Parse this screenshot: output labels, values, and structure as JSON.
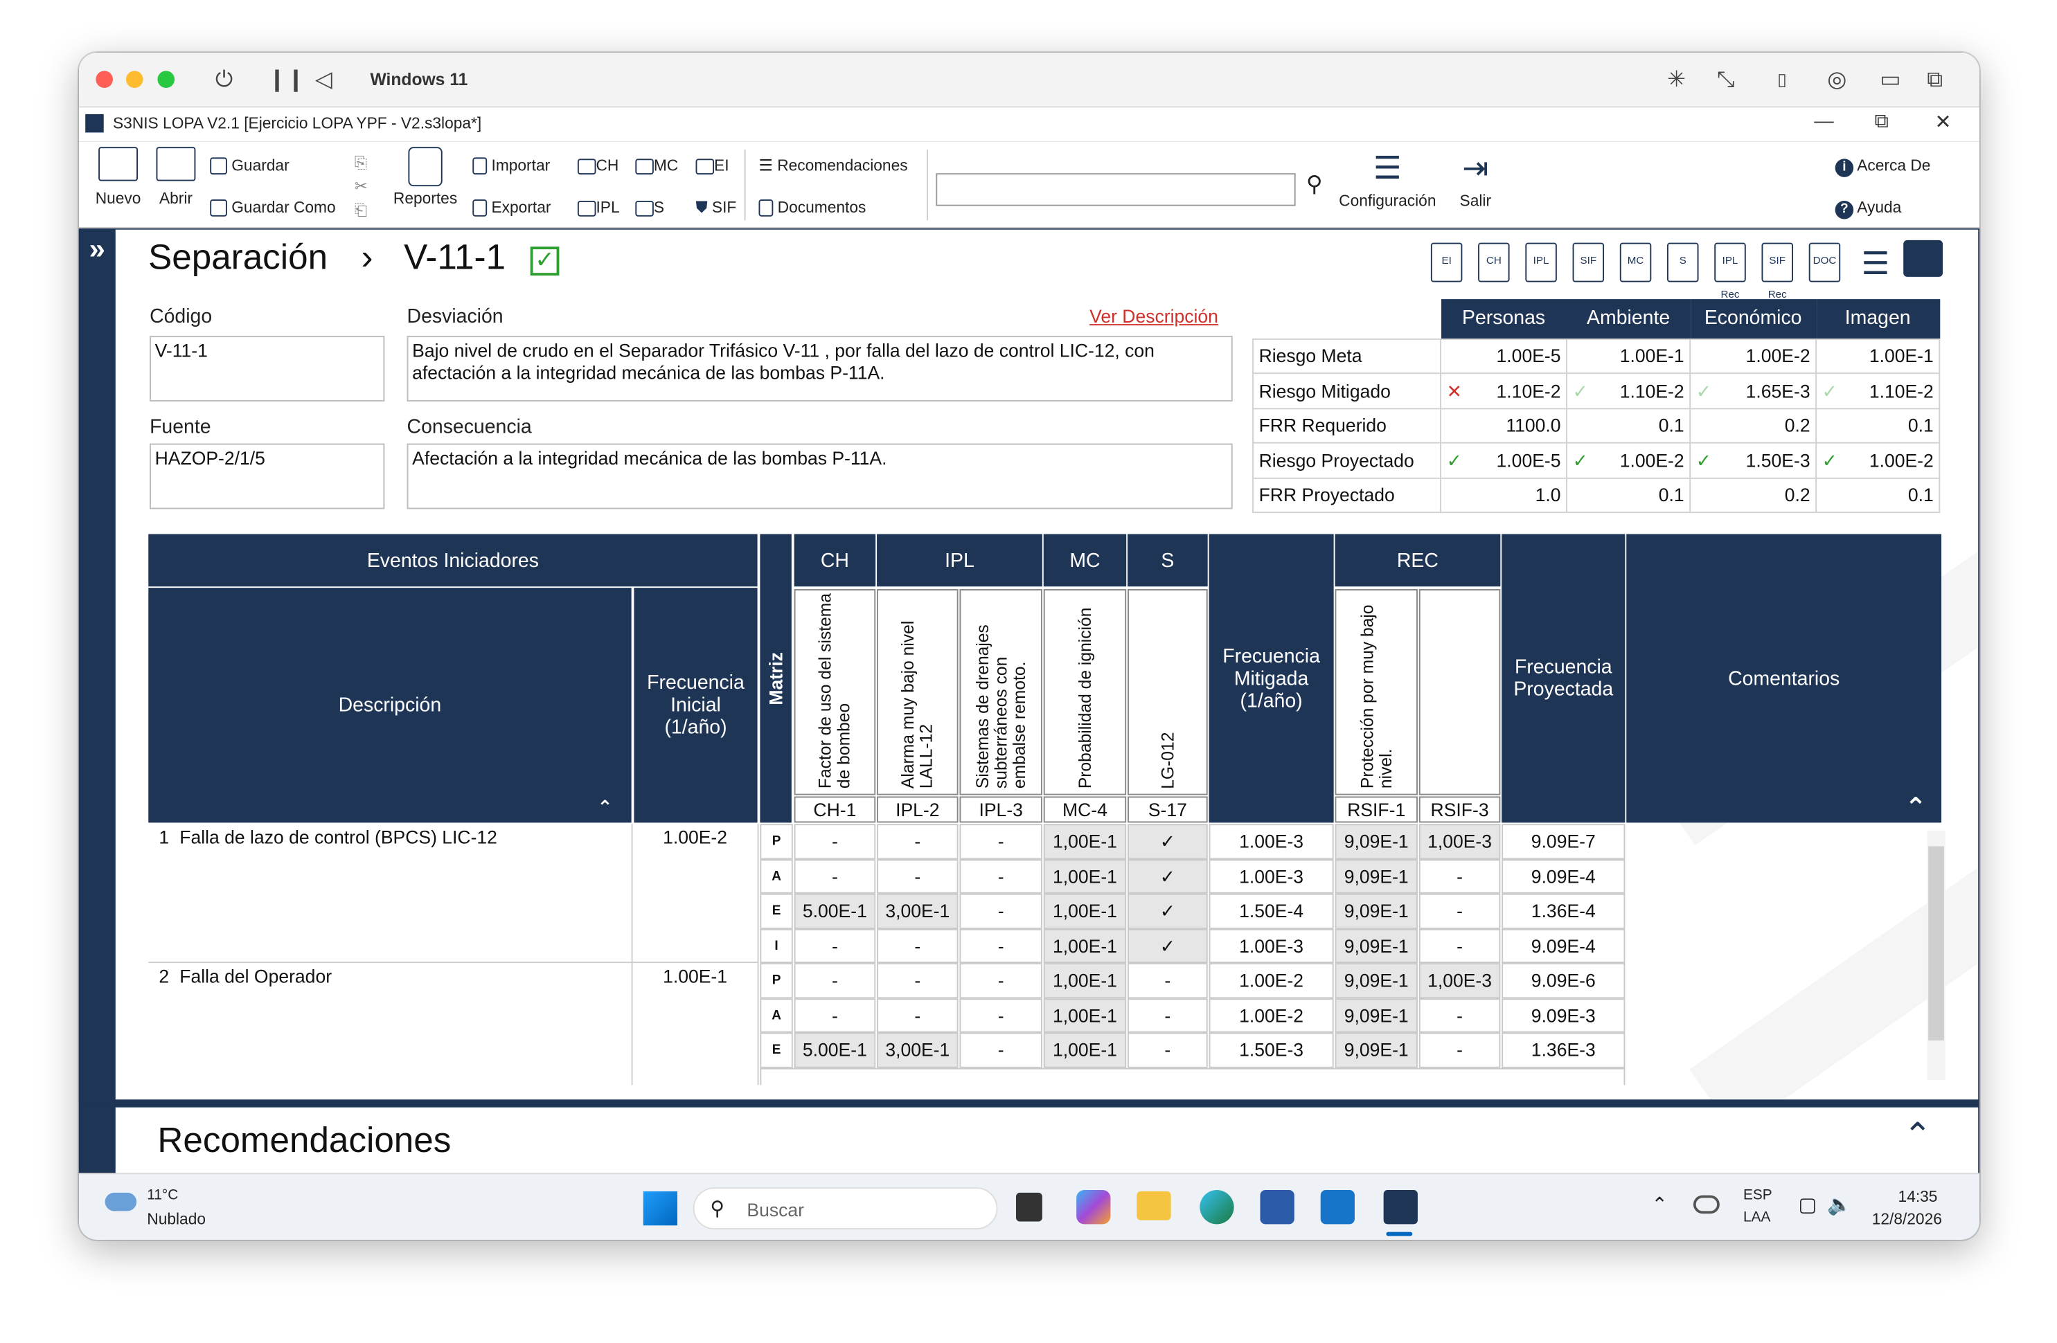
{
  "vm": {
    "title": "Windows 11"
  },
  "app": {
    "title": "S3NIS LOPA V2.1 [Ejercicio LOPA YPF - V2.s3lopa*]"
  },
  "ribbon": {
    "nuevo": "Nuevo",
    "abrir": "Abrir",
    "guardar": "Guardar",
    "guardar_como": "Guardar Como",
    "reportes": "Reportes",
    "importar": "Importar",
    "exportar": "Exportar",
    "ch": "CH",
    "mc": "MC",
    "ei": "EI",
    "ipl": "IPL",
    "s": "S",
    "sif": "SIF",
    "recomendaciones": "Recomendaciones",
    "documentos": "Documentos",
    "search_value": "",
    "configuracion": "Configuración",
    "salir": "Salir",
    "acerca": "Acerca De",
    "ayuda": "Ayuda"
  },
  "header": {
    "title": "Separación",
    "node": "V-11-1"
  },
  "toolbar_icons": [
    "EI",
    "CH",
    "IPL",
    "SIF",
    "MC",
    "S",
    "IPL Rec",
    "SIF Rec",
    "DOC"
  ],
  "form": {
    "codigo_label": "Código",
    "codigo": "V-11-1",
    "desviacion_label": "Desviación",
    "desviacion": "Bajo nivel de crudo en el Separador Trifásico V-11 , por falla del lazo de control LIC-12, con afectación a la integridad mecánica de las bombas P-11A.",
    "ver_descripcion": "Ver Descripción",
    "fuente_label": "Fuente",
    "fuente": "HAZOP-2/1/5",
    "consecuencia_label": "Consecuencia",
    "consecuencia": "Afectación a la integridad mecánica de las bombas P-11A."
  },
  "risk": {
    "headers": [
      "Personas",
      "Ambiente",
      "Económico",
      "Imagen"
    ],
    "rows": [
      {
        "label": "Riesgo Meta",
        "marks": [
          "",
          "",
          "",
          ""
        ],
        "values": [
          "1.00E-5",
          "1.00E-1",
          "1.00E-2",
          "1.00E-1"
        ]
      },
      {
        "label": "Riesgo Mitigado",
        "marks": [
          "✕",
          "✓",
          "✓",
          "✓"
        ],
        "values": [
          "1.10E-2",
          "1.10E-2",
          "1.65E-3",
          "1.10E-2"
        ]
      },
      {
        "label": "FRR Requerido",
        "marks": [
          "",
          "",
          "",
          ""
        ],
        "values": [
          "1100.0",
          "0.1",
          "0.2",
          "0.1"
        ]
      },
      {
        "label": "Riesgo Proyectado",
        "marks": [
          "✓",
          "✓",
          "✓",
          "✓"
        ],
        "values": [
          "1.00E-5",
          "1.00E-2",
          "1.50E-3",
          "1.00E-2"
        ]
      },
      {
        "label": "FRR Proyectado",
        "marks": [
          "",
          "",
          "",
          ""
        ],
        "values": [
          "1.0",
          "0.1",
          "0.2",
          "0.1"
        ]
      }
    ]
  },
  "grid": {
    "eventos_iniciadores": "Eventos Iniciadores",
    "descripcion": "Descripción",
    "frecuencia_inicial": "Frecuencia Inicial (1/año)",
    "matriz": "Matriz",
    "groups": {
      "ch": "CH",
      "ipl": "IPL",
      "mc": "MC",
      "s": "S",
      "rec": "REC"
    },
    "frecuencia_mitigada": "Frecuencia Mitigada (1/año)",
    "frecuencia_proyectada": "Frecuencia Proyectada",
    "comentarios": "Comentarios",
    "subcols": [
      {
        "label": "Factor de uso del sistema de bombeo",
        "code": "CH-1"
      },
      {
        "label": "Alarma muy bajo nivel LALL-12",
        "code": "IPL-2"
      },
      {
        "label": "Sistemas de drenajes subterráneos con embalse remoto.",
        "code": "IPL-3"
      },
      {
        "label": "Probabilidad de ignición",
        "code": "MC-4"
      },
      {
        "label": "LG-012",
        "code": "S-17"
      },
      {
        "label": "Protección por muy bajo nivel.",
        "code": "RSIF-1"
      },
      {
        "label": "",
        "code": "RSIF-3"
      }
    ],
    "events": [
      {
        "num": "1",
        "desc": "Falla de lazo de control (BPCS) LIC-12",
        "freq": "1.00E-2"
      },
      {
        "num": "2",
        "desc": "Falla del Operador",
        "freq": "1.00E-1"
      }
    ],
    "rows": [
      {
        "m": "P",
        "cells": [
          "-",
          "-",
          "-",
          "1,00E-1",
          "✓"
        ],
        "mit": "1.00E-3",
        "rec": [
          "9,09E-1",
          "1,00E-3"
        ],
        "proj": "9.09E-7"
      },
      {
        "m": "A",
        "cells": [
          "-",
          "-",
          "-",
          "1,00E-1",
          "✓"
        ],
        "mit": "1.00E-3",
        "rec": [
          "9,09E-1",
          "-"
        ],
        "proj": "9.09E-4"
      },
      {
        "m": "E",
        "cells": [
          "5.00E-1",
          "3,00E-1",
          "-",
          "1,00E-1",
          "✓"
        ],
        "mit": "1.50E-4",
        "rec": [
          "9,09E-1",
          "-"
        ],
        "proj": "1.36E-4"
      },
      {
        "m": "I",
        "cells": [
          "-",
          "-",
          "-",
          "1,00E-1",
          "✓"
        ],
        "mit": "1.00E-3",
        "rec": [
          "9,09E-1",
          "-"
        ],
        "proj": "9.09E-4"
      },
      {
        "m": "P",
        "cells": [
          "-",
          "-",
          "-",
          "1,00E-1",
          "-"
        ],
        "mit": "1.00E-2",
        "rec": [
          "9,09E-1",
          "1,00E-3"
        ],
        "proj": "9.09E-6"
      },
      {
        "m": "A",
        "cells": [
          "-",
          "-",
          "-",
          "1,00E-1",
          "-"
        ],
        "mit": "1.00E-2",
        "rec": [
          "9,09E-1",
          "-"
        ],
        "proj": "9.09E-3"
      },
      {
        "m": "E",
        "cells": [
          "5.00E-1",
          "3,00E-1",
          "-",
          "1,00E-1",
          "-"
        ],
        "mit": "1.50E-3",
        "rec": [
          "9,09E-1",
          "-"
        ],
        "proj": "1.36E-3"
      }
    ]
  },
  "recomendaciones": {
    "title": "Recomendaciones"
  },
  "taskbar": {
    "weather_temp": "11°C",
    "weather_desc": "Nublado",
    "search_placeholder": "Buscar",
    "lang1": "ESP",
    "lang2": "LAA",
    "time": "14:35",
    "date": "12/8/2026"
  },
  "colors": {
    "navy": "#1e3556",
    "accent_red": "#d0302b",
    "green": "#2e9e2e"
  }
}
